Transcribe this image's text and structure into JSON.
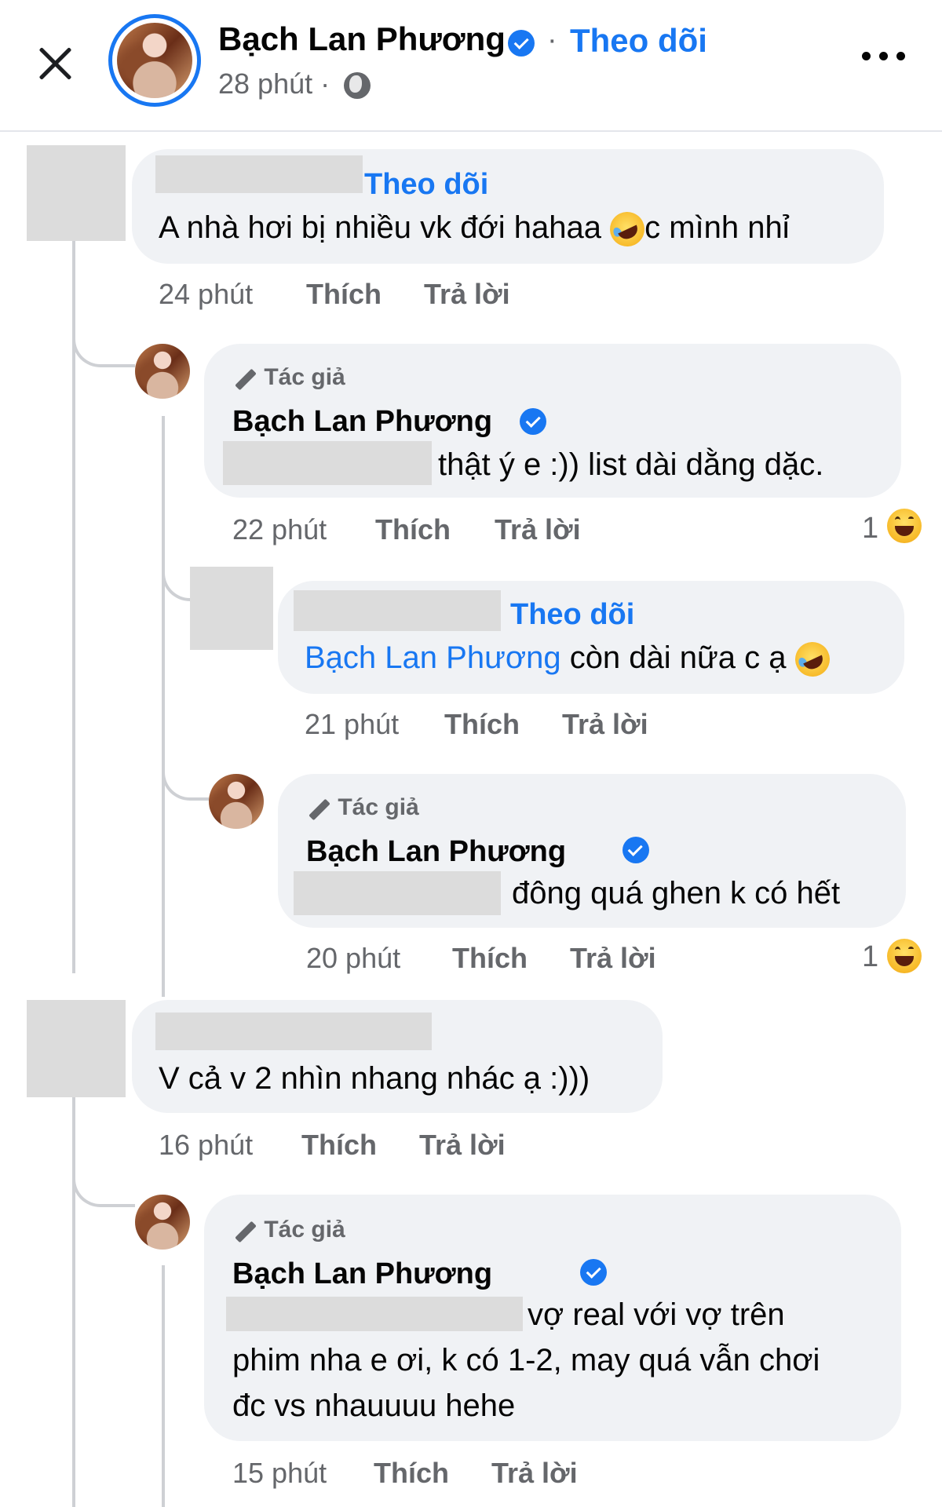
{
  "header": {
    "page_name": "Bạch Lan Phương",
    "separator": "·",
    "follow_label": "Theo dõi",
    "time": "28 phút ·"
  },
  "comments": [
    {
      "follow_label": "Theo dõi",
      "text": "A nhà hơi bị nhiều vk đới hahaa",
      "text_after_emoji": "c mình nhỉ",
      "time": "24 phút",
      "like_label": "Thích",
      "reply_label": "Trả lời"
    },
    {
      "author_badge": "Tác giả",
      "name": "Bạch Lan Phương",
      "text": "thật ý e :)) list dài dằng dặc.",
      "time": "22 phút",
      "like_label": "Thích",
      "reply_label": "Trả lời",
      "reaction_count": "1"
    },
    {
      "follow_label": "Theo dõi",
      "mention": "Bạch Lan Phương",
      "text": "còn dài nữa c ạ",
      "time": "21 phút",
      "like_label": "Thích",
      "reply_label": "Trả lời"
    },
    {
      "author_badge": "Tác giả",
      "name": "Bạch Lan Phương",
      "text": "đông quá ghen k có hết",
      "time": "20 phút",
      "like_label": "Thích",
      "reply_label": "Trả lời",
      "reaction_count": "1"
    },
    {
      "text": "V cả v 2 nhìn nhang nhác ạ :)))",
      "time": "16 phút",
      "like_label": "Thích",
      "reply_label": "Trả lời"
    },
    {
      "author_badge": "Tác giả",
      "name": "Bạch Lan Phương",
      "text_line1": "vợ real với vợ trên",
      "text_line2": "phim nha e ơi, k có 1-2, may quá vẫn chơi",
      "text_line3": "đc vs nhauuuu hehe",
      "time": "15 phút",
      "like_label": "Thích",
      "reply_label": "Trả lời"
    }
  ]
}
